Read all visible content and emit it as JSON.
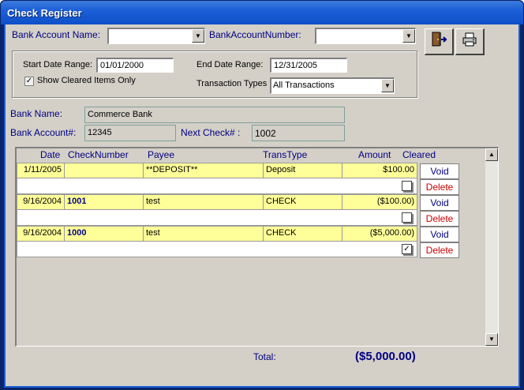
{
  "window": {
    "title": "Check Register"
  },
  "filters": {
    "bank_account_name_label": "Bank Account Name:",
    "bank_account_name_value": "",
    "bank_account_number_label": "BankAccountNumber:",
    "bank_account_number_value": "",
    "start_date_label": "Start Date Range:",
    "start_date_value": "01/01/2000",
    "end_date_label": "End Date Range:",
    "end_date_value": "12/31/2005",
    "show_cleared_label": "Show Cleared Items Only",
    "show_cleared_checked": true,
    "show_cleared_mark": "✓",
    "transaction_types_label": "Transaction Types",
    "transaction_types_value": "All Transactions"
  },
  "toolbar": {
    "exit_icon": "exit-door-icon",
    "print_icon": "printer-icon"
  },
  "bank_info": {
    "bank_name_label": "Bank Name:",
    "bank_name_value": "Commerce Bank",
    "bank_account_label": "Bank Account#:",
    "bank_account_value": "12345",
    "next_check_label": "Next Check# :",
    "next_check_value": "1002"
  },
  "grid": {
    "columns": [
      "Date",
      "CheckNumber",
      "Payee",
      "TransType",
      "Amount",
      "Cleared"
    ],
    "rows": [
      {
        "date": "1/11/2005",
        "check_number": "",
        "payee": "**DEPOSIT**",
        "trans_type": "Deposit",
        "amount": "$100.00",
        "cleared": false,
        "cleared_mark": "",
        "void_label": "Void",
        "delete_label": "Delete"
      },
      {
        "date": "9/16/2004",
        "check_number": "1001",
        "payee": "test",
        "trans_type": "CHECK",
        "amount": "($100.00)",
        "cleared": false,
        "cleared_mark": "",
        "void_label": "Void",
        "delete_label": "Delete"
      },
      {
        "date": "9/16/2004",
        "check_number": "1000",
        "payee": "test",
        "trans_type": "CHECK",
        "amount": "($5,000.00)",
        "cleared": true,
        "cleared_mark": "✓",
        "void_label": "Void",
        "delete_label": "Delete"
      }
    ]
  },
  "footer": {
    "total_label": "Total:",
    "total_value": "($5,000.00)"
  },
  "colors": {
    "title_bar": "#1c5fd6",
    "form_bg": "#d4d0c8",
    "row_highlight": "#ffff99",
    "label_text": "#000080",
    "delete_text": "#cc0000"
  }
}
